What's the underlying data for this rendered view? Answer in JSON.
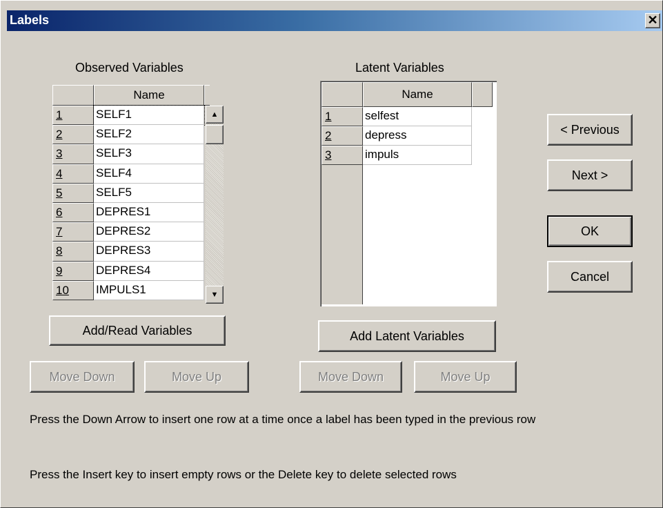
{
  "window": {
    "title": "Labels",
    "close_glyph": "✕"
  },
  "observed": {
    "heading": "Observed Variables",
    "column": "Name",
    "rows": [
      {
        "num": "1",
        "name": "SELF1"
      },
      {
        "num": "2",
        "name": "SELF2"
      },
      {
        "num": "3",
        "name": "SELF3"
      },
      {
        "num": "4",
        "name": "SELF4"
      },
      {
        "num": "5",
        "name": "SELF5"
      },
      {
        "num": "6",
        "name": "DEPRES1"
      },
      {
        "num": "7",
        "name": "DEPRES2"
      },
      {
        "num": "8",
        "name": "DEPRES3"
      },
      {
        "num": "9",
        "name": "DEPRES4"
      },
      {
        "num": "10",
        "name": "IMPULS1"
      }
    ],
    "add_button": "Add/Read Variables",
    "move_down": "Move Down",
    "move_up": "Move Up"
  },
  "latent": {
    "heading": "Latent Variables",
    "column": "Name",
    "rows": [
      {
        "num": "1",
        "name": "selfest"
      },
      {
        "num": "2",
        "name": "depress"
      },
      {
        "num": "3",
        "name": "impuls"
      }
    ],
    "add_button": "Add Latent Variables",
    "move_down": "Move Down",
    "move_up": "Move Up"
  },
  "buttons": {
    "previous": "< Previous",
    "next": "Next >",
    "ok": "OK",
    "cancel": "Cancel"
  },
  "notes": {
    "line1": "Press the Down Arrow to insert one row at a time once a label has been typed in the previous row",
    "line2": "Press the Insert key to insert empty rows or the Delete key to delete selected rows"
  },
  "icons": {
    "scroll_up": "scroll-up-arrow-icon",
    "scroll_down": "scroll-down-arrow-icon"
  }
}
